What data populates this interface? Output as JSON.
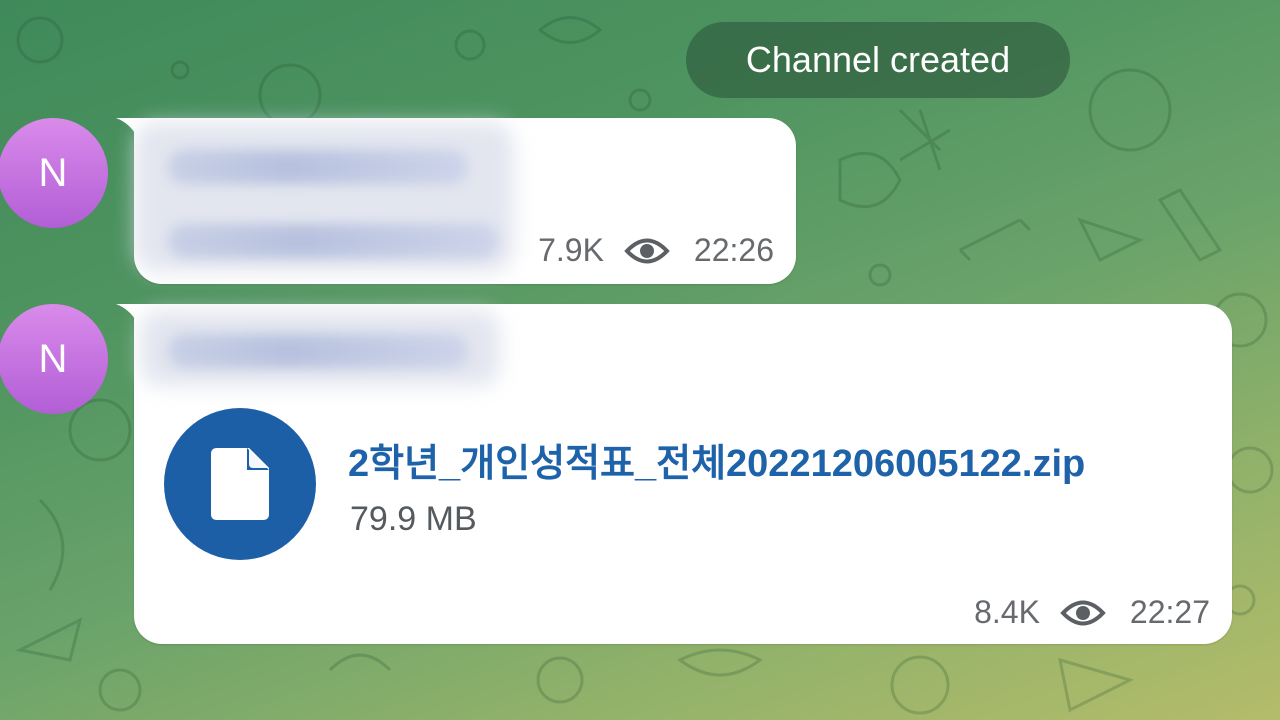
{
  "service_message": "Channel created",
  "colors": {
    "accent": "#1e62aa",
    "file_icon_bg": "#1d5fa6",
    "avatar": "#c276e0",
    "meta_text": "#666a6e"
  },
  "messages": [
    {
      "avatar_letter": "N",
      "views": "7.9K",
      "time": "22:26",
      "views_icon": "eye-icon"
    },
    {
      "avatar_letter": "N",
      "file": {
        "name": "2학년_개인성적표_전체20221206005122.zip",
        "size": "79.9 MB",
        "icon": "file-icon"
      },
      "views": "8.4K",
      "time": "22:27",
      "views_icon": "eye-icon"
    }
  ]
}
